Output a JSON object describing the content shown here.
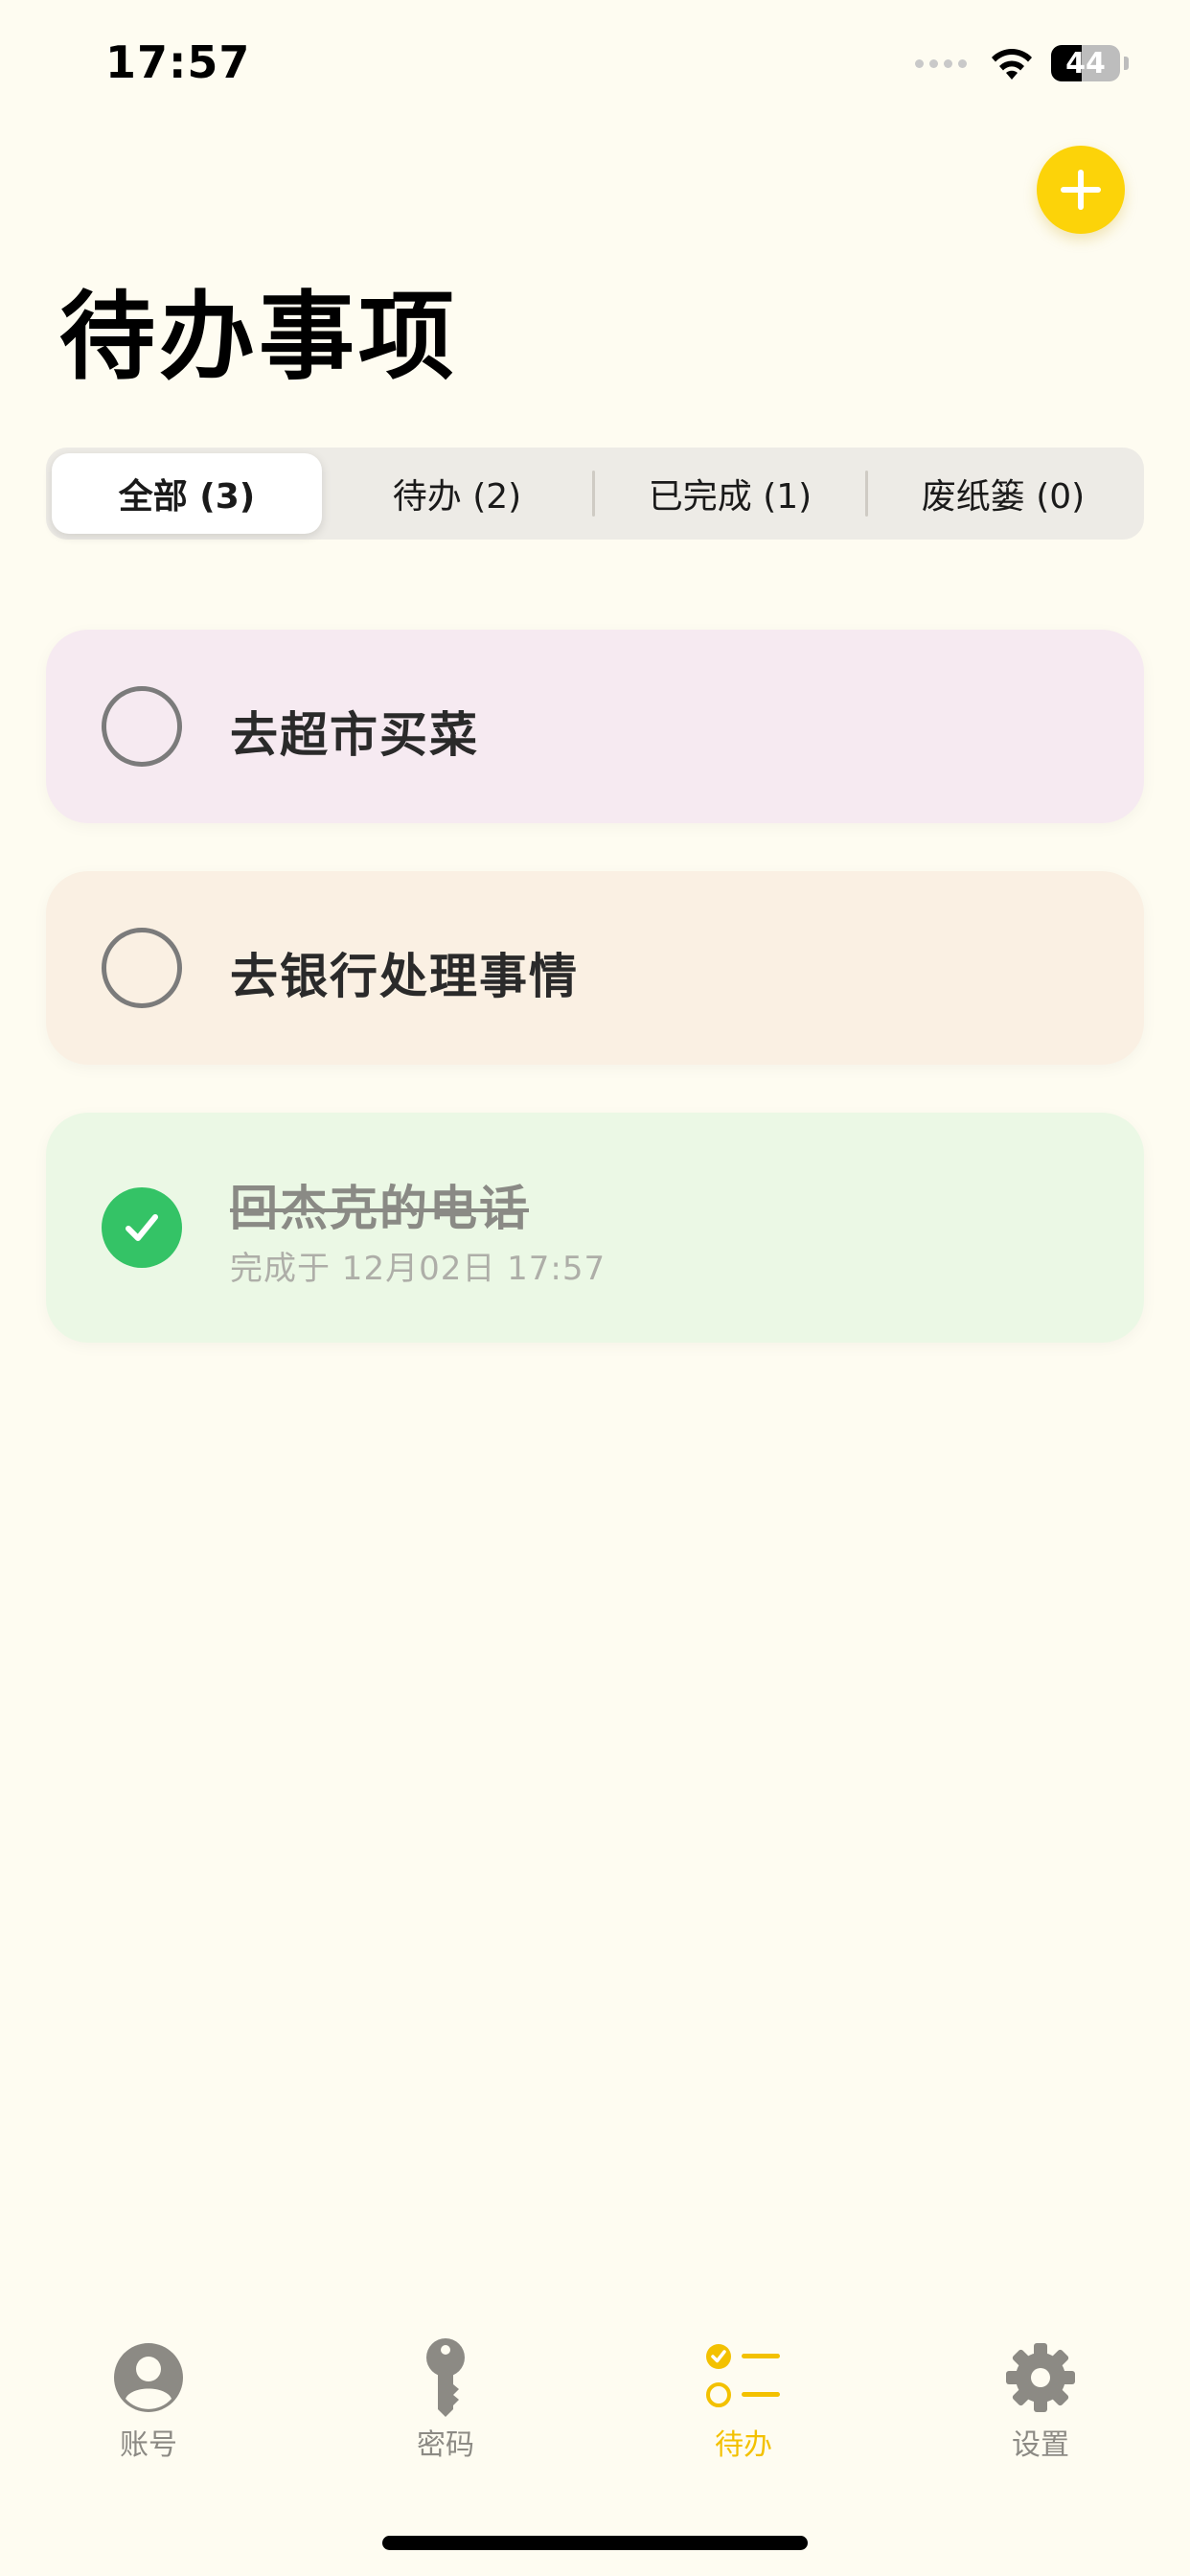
{
  "status_bar": {
    "time": "17:57",
    "battery": "44",
    "battery_level": 0.44,
    "wifi_icon": "wifi-icon"
  },
  "header": {
    "add_icon": "plus-icon",
    "title": "待办事项"
  },
  "filters": [
    {
      "label": "全部 (3)",
      "selected": true
    },
    {
      "label": "待办 (2)",
      "selected": false
    },
    {
      "label": "已完成 (1)",
      "selected": false
    },
    {
      "label": "废纸篓 (0)",
      "selected": false
    }
  ],
  "todos": [
    {
      "title": "去超市买菜",
      "completed": false,
      "color": "#F6EAF1"
    },
    {
      "title": "去银行处理事情",
      "completed": false,
      "color": "#FAF0E3"
    },
    {
      "title": "回杰克的电话",
      "completed": true,
      "completed_text": "完成于 12月02日 17:57",
      "color": "#EBF8E5"
    }
  ],
  "tab_bar": {
    "items": [
      {
        "label": "账号",
        "icon": "person-icon",
        "active": false
      },
      {
        "label": "密码",
        "icon": "key-icon",
        "active": false
      },
      {
        "label": "待办",
        "icon": "checklist-icon",
        "active": true
      },
      {
        "label": "设置",
        "icon": "gear-icon",
        "active": false
      }
    ]
  },
  "colors": {
    "accent": "#FCD309",
    "active_tab": "#F3C100",
    "done_green": "#34C366",
    "background": "#FEFCF1"
  }
}
